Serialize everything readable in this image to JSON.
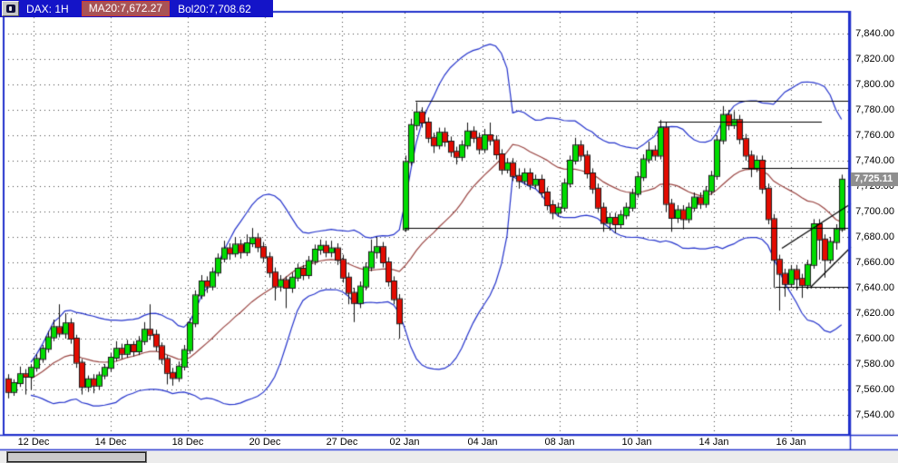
{
  "header": {
    "symbol": "DAX: 1H",
    "ma20_label": "MA20:7,672.27",
    "bol20_label": "Bol20:7,708.62"
  },
  "colors": {
    "header_bg": "#1414c8",
    "ma_badge_bg": "#a85356",
    "ma_badge_border": "#cf3b35",
    "candle_up": "#00dc00",
    "candle_down": "#e30b00",
    "candle_outline": "#1a1a1a",
    "ma_line": "#9a4542",
    "bollinger_line": "#2433cc",
    "frame": "#2030cc",
    "grid_dot": "#404040",
    "drawing_line": "#000000",
    "price_marker_bg": "#8f8f8f",
    "price_marker_text": "#ffffff"
  },
  "chart_data": {
    "type": "candlestick",
    "title": "DAX: 1H",
    "symbol": "DAX",
    "timeframe": "1H",
    "last_price": "7,725.11",
    "last_price_value": 7725.11,
    "legend": [
      "MA20:7,672.27",
      "Bol20:7,708.62"
    ],
    "indicators": {
      "ma_period": 20,
      "ma_value": 7672.27,
      "bollinger_period": 20,
      "bollinger_dev": 2,
      "bollinger_value": 7708.62
    },
    "y_axis": {
      "min": 7540,
      "max": 7840,
      "step": 20,
      "grid": true,
      "labels": [
        "7,840.00",
        "7,820.00",
        "7,800.00",
        "7,780.00",
        "7,760.00",
        "7,740.00",
        "7,720.00",
        "7,700.00",
        "7,680.00",
        "7,660.00",
        "7,640.00",
        "7,620.00",
        "7,600.00",
        "7,580.00",
        "7,560.00",
        "7,540.00"
      ]
    },
    "x_ticks": [
      {
        "label": "12 Dec",
        "x": 37
      },
      {
        "label": "14 Dec",
        "x": 122
      },
      {
        "label": "18 Dec",
        "x": 207
      },
      {
        "label": "20 Dec",
        "x": 292
      },
      {
        "label": "27 Dec",
        "x": 377
      },
      {
        "label": "02 Jan",
        "x": 446
      },
      {
        "label": "04 Jan",
        "x": 532
      },
      {
        "label": "08 Jan",
        "x": 617
      },
      {
        "label": "10 Jan",
        "x": 702
      },
      {
        "label": "14 Jan",
        "x": 787
      },
      {
        "label": "16 Jan",
        "x": 872
      }
    ],
    "x_start": 9,
    "x_step": 6.25,
    "candles": [
      [
        7568,
        7572,
        7553,
        7558
      ],
      [
        7558,
        7568,
        7555,
        7565
      ],
      [
        7565,
        7578,
        7562,
        7572
      ],
      [
        7572,
        7576,
        7556,
        7570
      ],
      [
        7570,
        7580,
        7560,
        7577
      ],
      [
        7577,
        7588,
        7574,
        7584
      ],
      [
        7584,
        7595,
        7581,
        7592
      ],
      [
        7592,
        7606,
        7589,
        7601
      ],
      [
        7601,
        7615,
        7598,
        7609
      ],
      [
        7609,
        7627,
        7601,
        7604
      ],
      [
        7604,
        7620,
        7600,
        7612
      ],
      [
        7612,
        7616,
        7596,
        7600
      ],
      [
        7600,
        7603,
        7577,
        7581
      ],
      [
        7581,
        7584,
        7556,
        7562
      ],
      [
        7562,
        7571,
        7558,
        7568
      ],
      [
        7568,
        7572,
        7557,
        7563
      ],
      [
        7563,
        7574,
        7560,
        7571
      ],
      [
        7571,
        7580,
        7568,
        7577
      ],
      [
        7577,
        7589,
        7574,
        7585
      ],
      [
        7585,
        7598,
        7582,
        7592
      ],
      [
        7592,
        7596,
        7584,
        7588
      ],
      [
        7588,
        7599,
        7585,
        7595
      ],
      [
        7595,
        7598,
        7586,
        7590
      ],
      [
        7590,
        7602,
        7587,
        7598
      ],
      [
        7598,
        7613,
        7595,
        7607
      ],
      [
        7607,
        7627,
        7599,
        7603
      ],
      [
        7603,
        7607,
        7590,
        7594
      ],
      [
        7594,
        7597,
        7580,
        7584
      ],
      [
        7584,
        7587,
        7564,
        7573
      ],
      [
        7573,
        7577,
        7563,
        7569
      ],
      [
        7569,
        7582,
        7566,
        7578
      ],
      [
        7578,
        7595,
        7575,
        7591
      ],
      [
        7591,
        7616,
        7588,
        7612
      ],
      [
        7612,
        7638,
        7609,
        7634
      ],
      [
        7634,
        7650,
        7631,
        7645
      ],
      [
        7645,
        7649,
        7636,
        7641
      ],
      [
        7641,
        7656,
        7638,
        7652
      ],
      [
        7652,
        7667,
        7649,
        7663
      ],
      [
        7663,
        7677,
        7660,
        7671
      ],
      [
        7671,
        7675,
        7662,
        7667
      ],
      [
        7667,
        7680,
        7664,
        7674
      ],
      [
        7674,
        7678,
        7663,
        7668
      ],
      [
        7668,
        7682,
        7665,
        7675
      ],
      [
        7675,
        7687,
        7672,
        7679
      ],
      [
        7679,
        7683,
        7668,
        7672
      ],
      [
        7672,
        7676,
        7660,
        7664
      ],
      [
        7664,
        7668,
        7648,
        7652
      ],
      [
        7652,
        7656,
        7630,
        7641
      ],
      [
        7641,
        7650,
        7637,
        7646
      ],
      [
        7646,
        7649,
        7624,
        7640
      ],
      [
        7640,
        7652,
        7636,
        7648
      ],
      [
        7648,
        7659,
        7645,
        7655
      ],
      [
        7655,
        7658,
        7646,
        7650
      ],
      [
        7650,
        7665,
        7647,
        7661
      ],
      [
        7661,
        7674,
        7658,
        7670
      ],
      [
        7670,
        7678,
        7666,
        7673
      ],
      [
        7673,
        7677,
        7664,
        7668
      ],
      [
        7668,
        7677,
        7664,
        7671
      ],
      [
        7671,
        7675,
        7658,
        7662
      ],
      [
        7662,
        7666,
        7644,
        7648
      ],
      [
        7648,
        7652,
        7627,
        7636
      ],
      [
        7636,
        7640,
        7613,
        7628
      ],
      [
        7628,
        7645,
        7624,
        7641
      ],
      [
        7641,
        7660,
        7638,
        7656
      ],
      [
        7656,
        7678,
        7653,
        7668
      ],
      [
        7668,
        7680,
        7663,
        7672
      ],
      [
        7672,
        7676,
        7656,
        7660
      ],
      [
        7660,
        7664,
        7641,
        7645
      ],
      [
        7645,
        7649,
        7627,
        7631
      ],
      [
        7631,
        7635,
        7600,
        7612
      ],
      [
        7686,
        7744,
        7684,
        7739
      ],
      [
        7739,
        7773,
        7736,
        7768
      ],
      [
        7768,
        7786,
        7764,
        7778
      ],
      [
        7778,
        7782,
        7766,
        7770
      ],
      [
        7770,
        7774,
        7754,
        7758
      ],
      [
        7758,
        7762,
        7746,
        7752
      ],
      [
        7752,
        7766,
        7749,
        7762
      ],
      [
        7762,
        7766,
        7751,
        7755
      ],
      [
        7755,
        7759,
        7743,
        7747
      ],
      [
        7747,
        7751,
        7737,
        7743
      ],
      [
        7743,
        7756,
        7740,
        7752
      ],
      [
        7752,
        7770,
        7749,
        7763
      ],
      [
        7763,
        7767,
        7754,
        7758
      ],
      [
        7758,
        7762,
        7745,
        7749
      ],
      [
        7749,
        7765,
        7746,
        7760
      ],
      [
        7760,
        7770,
        7752,
        7756
      ],
      [
        7756,
        7760,
        7741,
        7745
      ],
      [
        7745,
        7749,
        7729,
        7733
      ],
      [
        7733,
        7742,
        7730,
        7738
      ],
      [
        7738,
        7742,
        7724,
        7728
      ],
      [
        7728,
        7734,
        7718,
        7724
      ],
      [
        7724,
        7734,
        7721,
        7730
      ],
      [
        7730,
        7734,
        7717,
        7721
      ],
      [
        7721,
        7729,
        7718,
        7725
      ],
      [
        7725,
        7729,
        7711,
        7715
      ],
      [
        7715,
        7719,
        7701,
        7705
      ],
      [
        7705,
        7709,
        7694,
        7699
      ],
      [
        7699,
        7707,
        7696,
        7703
      ],
      [
        7703,
        7726,
        7700,
        7722
      ],
      [
        7722,
        7744,
        7719,
        7740
      ],
      [
        7740,
        7758,
        7737,
        7752
      ],
      [
        7752,
        7756,
        7740,
        7744
      ],
      [
        7744,
        7748,
        7726,
        7730
      ],
      [
        7730,
        7734,
        7714,
        7718
      ],
      [
        7718,
        7722,
        7699,
        7703
      ],
      [
        7703,
        7707,
        7684,
        7691
      ],
      [
        7691,
        7699,
        7685,
        7695
      ],
      [
        7695,
        7699,
        7683,
        7690
      ],
      [
        7690,
        7701,
        7687,
        7697
      ],
      [
        7697,
        7707,
        7694,
        7703
      ],
      [
        7703,
        7718,
        7700,
        7714
      ],
      [
        7714,
        7731,
        7711,
        7727
      ],
      [
        7727,
        7745,
        7724,
        7741
      ],
      [
        7741,
        7755,
        7738,
        7748
      ],
      [
        7748,
        7752,
        7740,
        7744
      ],
      [
        7744,
        7772,
        7741,
        7766
      ],
      [
        7766,
        7770,
        7700,
        7706
      ],
      [
        7706,
        7710,
        7684,
        7695
      ],
      [
        7695,
        7705,
        7691,
        7701
      ],
      [
        7701,
        7705,
        7686,
        7694
      ],
      [
        7694,
        7707,
        7691,
        7703
      ],
      [
        7703,
        7715,
        7700,
        7711
      ],
      [
        7711,
        7715,
        7702,
        7706
      ],
      [
        7706,
        7720,
        7703,
        7716
      ],
      [
        7716,
        7732,
        7713,
        7728
      ],
      [
        7728,
        7760,
        7725,
        7756
      ],
      [
        7756,
        7783,
        7753,
        7776
      ],
      [
        7776,
        7780,
        7764,
        7768
      ],
      [
        7768,
        7779,
        7765,
        7772
      ],
      [
        7772,
        7776,
        7753,
        7757
      ],
      [
        7757,
        7761,
        7740,
        7744
      ],
      [
        7744,
        7748,
        7727,
        7734
      ],
      [
        7734,
        7744,
        7731,
        7740
      ],
      [
        7740,
        7744,
        7714,
        7718
      ],
      [
        7718,
        7722,
        7690,
        7694
      ],
      [
        7694,
        7698,
        7640,
        7662
      ],
      [
        7662,
        7666,
        7622,
        7651
      ],
      [
        7651,
        7655,
        7633,
        7643
      ],
      [
        7643,
        7658,
        7640,
        7654
      ],
      [
        7654,
        7658,
        7638,
        7647
      ],
      [
        7647,
        7651,
        7632,
        7642
      ],
      [
        7642,
        7662,
        7639,
        7658
      ],
      [
        7658,
        7694,
        7655,
        7690
      ],
      [
        7690,
        7694,
        7662,
        7678
      ],
      [
        7678,
        7682,
        7648,
        7662
      ],
      [
        7662,
        7680,
        7659,
        7676
      ],
      [
        7676,
        7690,
        7670,
        7686
      ],
      [
        7686,
        7729,
        7684,
        7725.11
      ]
    ],
    "drawings": {
      "hlines": [
        {
          "price": 7787,
          "x1": 458,
          "x2": 937
        },
        {
          "price": 7687,
          "x1": 446,
          "x2": 937
        },
        {
          "price": 7771,
          "x1": 726,
          "x2": 906
        },
        {
          "price": 7734,
          "x1": 818,
          "x2": 937
        },
        {
          "price": 7641,
          "x1": 855,
          "x2": 936
        }
      ],
      "trendlines": [
        {
          "x1": 862,
          "p1": 7671,
          "x2": 938,
          "p2": 7706
        },
        {
          "x1": 893,
          "p1": 7640,
          "x2": 938,
          "p2": 7672
        }
      ]
    }
  }
}
